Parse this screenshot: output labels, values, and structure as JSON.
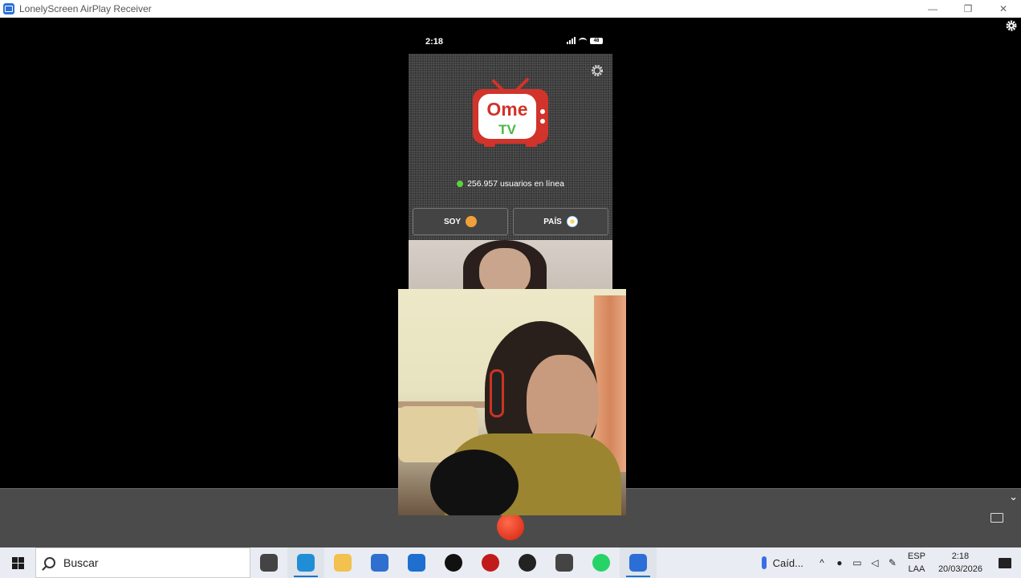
{
  "window": {
    "title": "LonelyScreen AirPlay Receiver",
    "minimize": "—",
    "restore": "❐",
    "close": "✕"
  },
  "phone": {
    "status_time": "2:18",
    "battery": "48",
    "app": {
      "logo_top": "Ome",
      "logo_bottom": "TV",
      "online_text": "256.957 usuarios en línea",
      "online_color": "#5bd33c",
      "button_soy": "SOY",
      "button_pais": "PAÍS"
    }
  },
  "toolbar": {
    "chevron": "⌄"
  },
  "taskbar": {
    "search_placeholder": "Buscar",
    "weather_text": "Caíd...",
    "lang_line1": "ESP",
    "lang_line2": "LAA",
    "time": "2:18",
    "date": "20/03/2026",
    "apps": [
      {
        "name": "task-view-icon",
        "color": "#444"
      },
      {
        "name": "edge-icon",
        "color": "#1f8ed6"
      },
      {
        "name": "file-explorer-icon",
        "color": "#f2c14e"
      },
      {
        "name": "microsoft-store-icon",
        "color": "#2f6fd0"
      },
      {
        "name": "outlook-icon",
        "color": "#1e6fcf"
      },
      {
        "name": "tiktok-icon",
        "color": "#111"
      },
      {
        "name": "red-app-icon",
        "color": "#c21a1a"
      },
      {
        "name": "record-app-icon",
        "color": "#222"
      },
      {
        "name": "settings-icon",
        "color": "#444"
      },
      {
        "name": "whatsapp-icon",
        "color": "#25d366"
      },
      {
        "name": "lonelyscreen-icon",
        "color": "#2b6fd6"
      }
    ]
  }
}
